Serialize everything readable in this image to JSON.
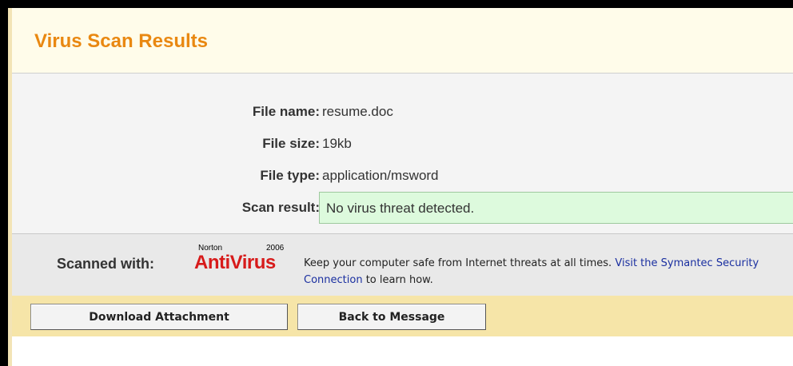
{
  "page": {
    "title": "Virus Scan Results"
  },
  "file_details": {
    "name_label": "File name:",
    "name_value": "resume.doc",
    "size_label": "File size:",
    "size_value": "19kb",
    "type_label": "File type:",
    "type_value": "application/msword",
    "result_label": "Scan result:",
    "result_value": "No virus threat detected."
  },
  "scanner": {
    "label": "Scanned with:",
    "logo": {
      "maker": "Norton",
      "year": "2006",
      "product": "AntiVirus"
    },
    "promo_text": "Keep your computer safe from Internet threats at all times.",
    "promo_link": "Visit the Symantec Security Connection",
    "promo_suffix": "to learn how."
  },
  "actions": {
    "download_label": "Download Attachment",
    "back_label": "Back to Message"
  },
  "colors": {
    "title": "#e98811",
    "result_bg": "#ddfadd",
    "brand_red": "#d71b1b",
    "link": "#1a2fa0",
    "action_bar": "#f6e5a8"
  }
}
